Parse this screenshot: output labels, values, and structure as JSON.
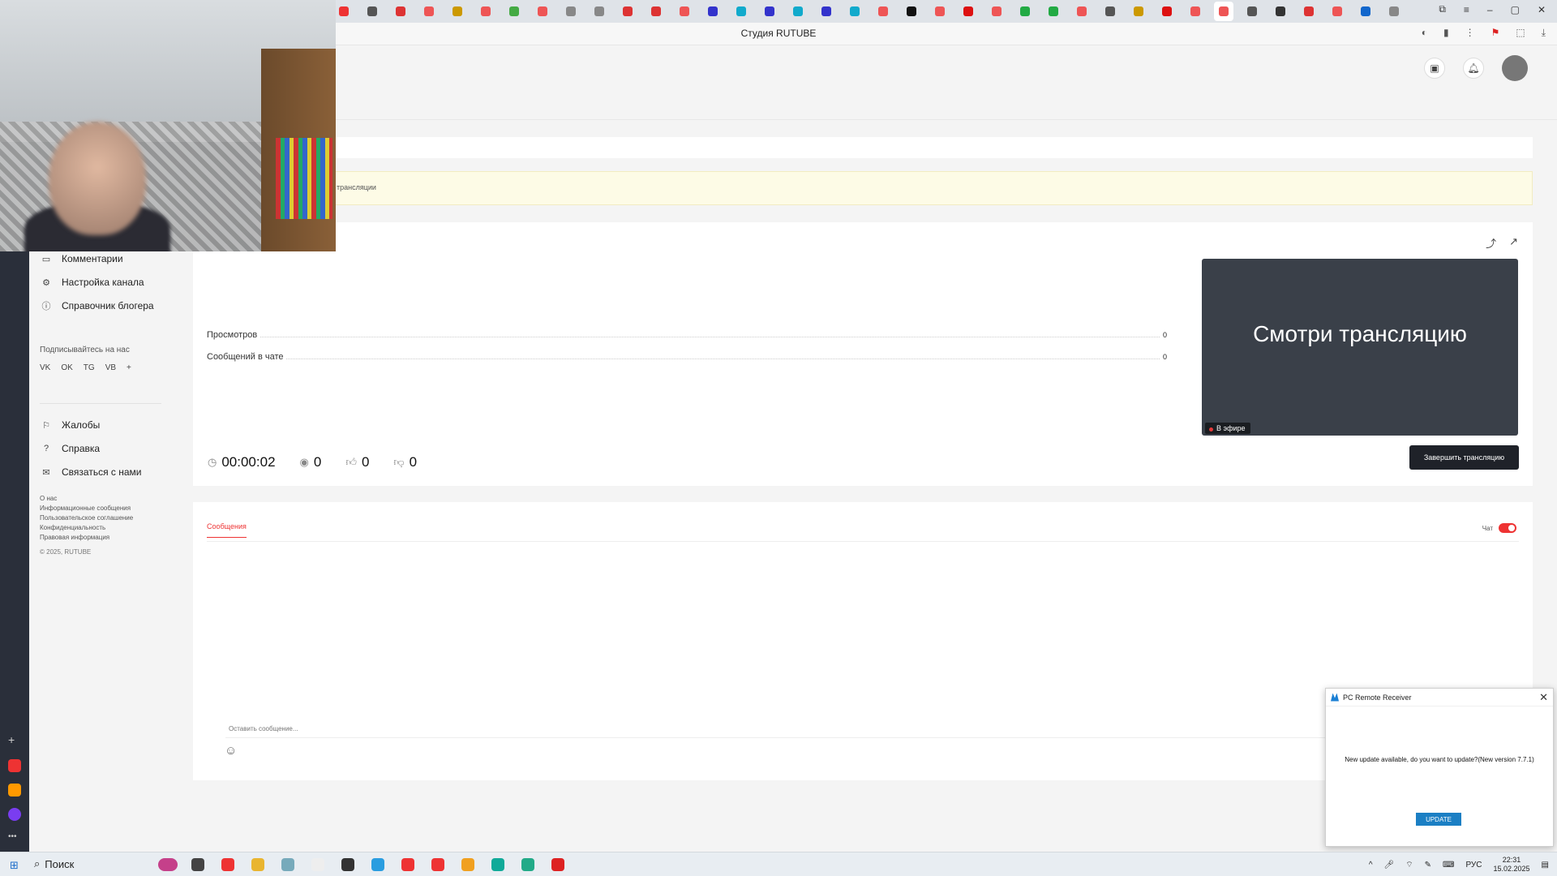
{
  "browser": {
    "title": "Студия RUTUBE",
    "tab_colors": [
      "#e33",
      "#555",
      "#d33",
      "#e55",
      "#c90",
      "#e55",
      "#4a4",
      "#e55",
      "#888",
      "#888",
      "#d33",
      "#d33",
      "#e55",
      "#33c",
      "#1ac",
      "#33c",
      "#1ac",
      "#33c",
      "#1ac",
      "#e55",
      "#111",
      "#e55",
      "#d11",
      "#e55",
      "#2a4",
      "#2a4",
      "#e55",
      "#555",
      "#c90",
      "#d11",
      "#e55",
      "#e55",
      "#555",
      "#333",
      "#d33",
      "#e55",
      "#16c",
      "#888"
    ]
  },
  "header": {
    "icons": [
      "screen-icon",
      "bell-icon",
      "avatar"
    ]
  },
  "nav": {
    "items": [
      {
        "label": "Комментарии",
        "icon": "comment-icon"
      },
      {
        "label": "Настройка канала",
        "icon": "gear-icon"
      },
      {
        "label": "Справочник блогера",
        "icon": "info-icon"
      }
    ],
    "follow_title": "Подписывайтесь на нас",
    "social": [
      "VK",
      "OK",
      "TG",
      "VB",
      "+"
    ],
    "support_items": [
      {
        "label": "Жалобы",
        "icon": "flag-icon"
      },
      {
        "label": "Справка",
        "icon": "help-icon"
      },
      {
        "label": "Связаться с нами",
        "icon": "mail-icon"
      }
    ],
    "footer_links": [
      "О нас",
      "Информационные сообщения",
      "Пользовательское соглашение",
      "Конфиденциальность",
      "Правовая информация"
    ],
    "copyright": "© 2025, RUTUBE"
  },
  "notice": {
    "text": "трансляции"
  },
  "stats": {
    "rows": [
      {
        "label": "Просмотров",
        "value": "0"
      },
      {
        "label": "Сообщений в чате",
        "value": "0"
      }
    ],
    "timer": "00:00:02",
    "viewers": "0",
    "likes": "0",
    "dislikes": "0"
  },
  "preview": {
    "title": "Смотри трансляцию",
    "live_badge": "В эфире"
  },
  "end_button": "Завершить трансляцию",
  "chat": {
    "tab": "Сообщения",
    "toggle_label": "Чат",
    "placeholder": "Оставить сообщение..."
  },
  "popup": {
    "title": "PC Remote Receiver",
    "message": "New update available, do you want to update?(New version 7.7.1)",
    "button": "UPDATE"
  },
  "taskbar": {
    "search": "Поиск",
    "lang": "РУС",
    "time": "22:31",
    "date": "15.02.2025",
    "app_colors": [
      "#c5408a",
      "#444",
      "#e33",
      "#e9b530",
      "#7ab",
      "#eee",
      "#333",
      "#2a9de0",
      "#e33",
      "#e33",
      "#f0a020",
      "#1a9",
      "#2a8",
      "#d22"
    ]
  }
}
